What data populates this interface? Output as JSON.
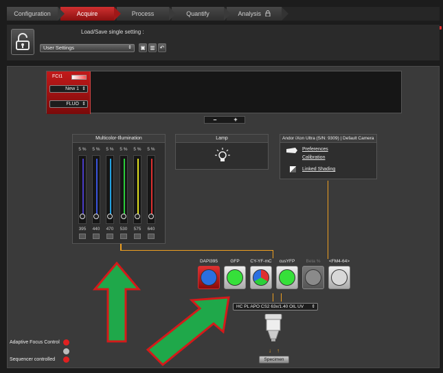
{
  "workflow_tabs": [
    {
      "label": "Configuration"
    },
    {
      "label": "Acquire"
    },
    {
      "label": "Process"
    },
    {
      "label": "Quantify"
    },
    {
      "label": "Analysis"
    }
  ],
  "settings": {
    "load_save_label": "Load/Save single setting :",
    "selected_setting": "User Settings"
  },
  "fc": {
    "label": "FCt1",
    "name_select": "New 1",
    "mode_select": "FLUO"
  },
  "controls": {
    "minus": "–",
    "plus": "+"
  },
  "multicolor": {
    "title": "Multicolor-Illumination",
    "channels": [
      {
        "percent": "5 %",
        "wavelength": "395",
        "color": "#4b3cc8"
      },
      {
        "percent": "5 %",
        "wavelength": "440",
        "color": "#3a55e0"
      },
      {
        "percent": "5 %",
        "wavelength": "470",
        "color": "#22a0e0"
      },
      {
        "percent": "5 %",
        "wavelength": "530",
        "color": "#2bd03a"
      },
      {
        "percent": "5 %",
        "wavelength": "575",
        "color": "#e0e020"
      },
      {
        "percent": "5 %",
        "wavelength": "640",
        "color": "#e03030"
      }
    ]
  },
  "lamp": {
    "title": "Lamp"
  },
  "camera": {
    "title": "Andor iXon Ultra (S/N: 9309) | Default Camera",
    "preferences": "Preferences",
    "calibration": "Calibration",
    "linked_shading": "Linked Shading"
  },
  "filter_cubes": [
    {
      "label": "DAPI395",
      "selected": true,
      "fill": "#2b6fe0"
    },
    {
      "label": "GFP",
      "selected": false,
      "fill": "#36e03a"
    },
    {
      "label": "CY-YF-mC",
      "selected": false,
      "fill": "multi"
    },
    {
      "label": "cusYFP",
      "selected": false,
      "fill": "#36e03a"
    },
    {
      "label": "Beta %",
      "selected": false,
      "fill": "#8a8a8a",
      "disabled": true
    },
    {
      "label": "<FM4-64>",
      "selected": false,
      "fill": "#d8d8d8"
    }
  ],
  "objective": "HC PL APO CS2  63x/1.40 OIL  UV",
  "specimen": "Specimen",
  "status": {
    "adaptive_focus": "Adaptive Focus Control",
    "sequencer": "Sequencer controlled"
  },
  "colors": {
    "accent_red": "#c21a1a",
    "wire_orange": "#f0a020",
    "arrow_green": "#1fa84a"
  }
}
